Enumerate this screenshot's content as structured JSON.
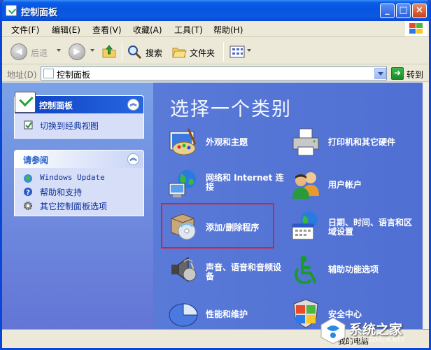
{
  "window": {
    "title": "控制面板",
    "minimize_glyph": "_",
    "maximize_glyph": "□",
    "close_glyph": "×"
  },
  "menu": [
    "文件(F)",
    "编辑(E)",
    "查看(V)",
    "收藏(A)",
    "工具(T)",
    "帮助(H)"
  ],
  "toolbar": {
    "back_label": "后退",
    "search_label": "搜索",
    "folders_label": "文件夹"
  },
  "address": {
    "label": "地址(D)",
    "value": "控制面板",
    "go_label": "转到"
  },
  "left_pane": {
    "panel1": {
      "title": "控制面板",
      "links": [
        "切换到经典视图"
      ]
    },
    "panel2": {
      "title": "请参阅",
      "links": [
        "Windows Update",
        "帮助和支持",
        "其它控制面板选项"
      ]
    }
  },
  "main": {
    "heading": "选择一个类别",
    "categories": [
      {
        "label": "外观和主题",
        "icon": "appearance-icon"
      },
      {
        "label": "打印机和其它硬件",
        "icon": "printer-icon"
      },
      {
        "label": "网络和 Internet 连接",
        "icon": "network-icon"
      },
      {
        "label": "用户帐户",
        "icon": "users-icon"
      },
      {
        "label": "添加/删除程序",
        "icon": "add-remove-programs-icon"
      },
      {
        "label": "日期、时间、语言和区域设置",
        "icon": "date-time-icon"
      },
      {
        "label": "声音、语音和音频设备",
        "icon": "sound-icon"
      },
      {
        "label": "辅助功能选项",
        "icon": "accessibility-icon"
      },
      {
        "label": "性能和维护",
        "icon": "performance-icon"
      },
      {
        "label": "安全中心",
        "icon": "security-center-icon"
      }
    ]
  },
  "status": {
    "text": "我的电脑"
  },
  "watermark": {
    "text": "系统之家",
    "url": "XITONGZHIJIA.NET"
  },
  "colors": {
    "titlebar": "#0a5ee8",
    "left_pane": "#7ba2e7",
    "main_pane": "#5a7ad8",
    "highlight": "#e21f26"
  }
}
